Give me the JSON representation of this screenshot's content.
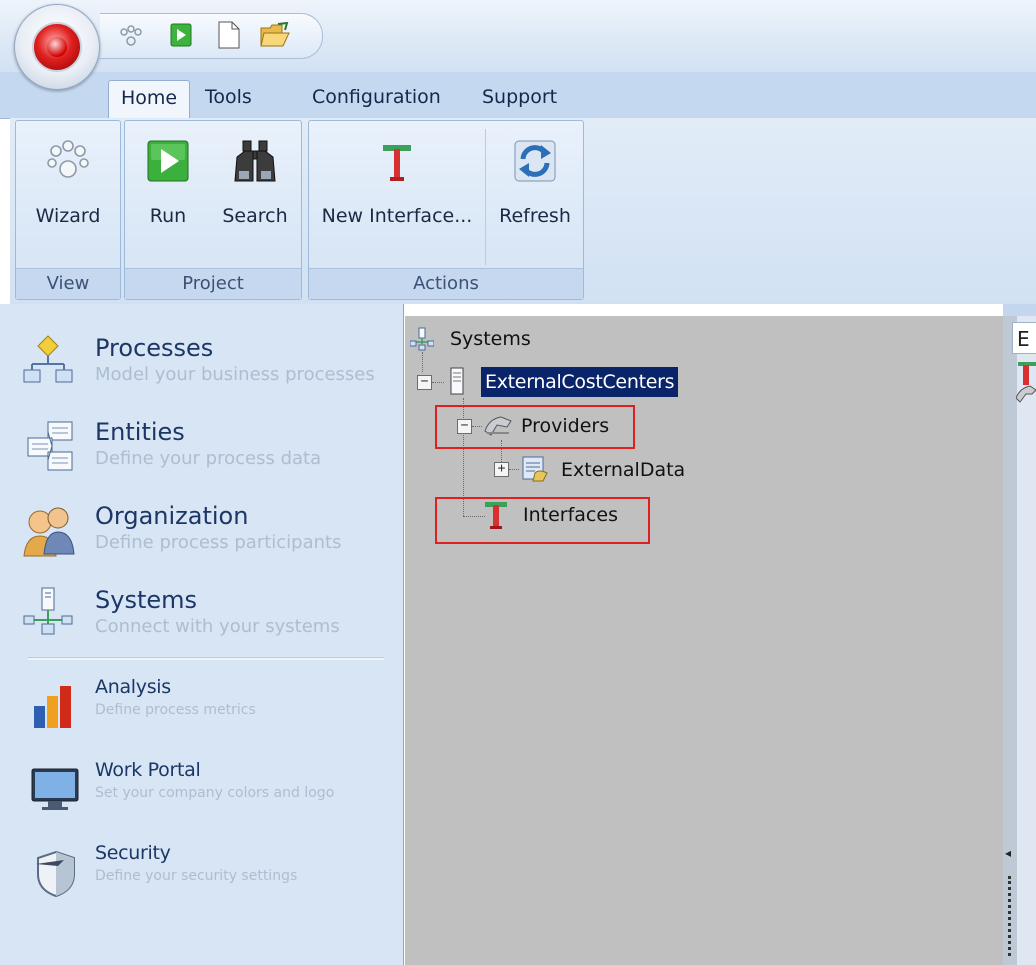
{
  "ribbon": {
    "tabs": [
      "Home",
      "Tools",
      "Configuration",
      "Support"
    ],
    "groups": {
      "view": {
        "label": "View",
        "buttons": {
          "wizard": "Wizard"
        }
      },
      "project": {
        "label": "Project",
        "buttons": {
          "run": "Run",
          "search": "Search"
        }
      },
      "actions": {
        "label": "Actions",
        "buttons": {
          "new_interface": "New Interface...",
          "refresh": "Refresh"
        }
      }
    }
  },
  "nav": {
    "processes": {
      "title": "Processes",
      "subtitle": "Model your business processes"
    },
    "entities": {
      "title": "Entities",
      "subtitle": "Define your process data"
    },
    "organization": {
      "title": "Organization",
      "subtitle": "Define process participants"
    },
    "systems": {
      "title": "Systems",
      "subtitle": "Connect with your systems"
    },
    "analysis": {
      "title": "Analysis",
      "subtitle": "Define process metrics"
    },
    "work_portal": {
      "title": "Work Portal",
      "subtitle": "Set your company colors and logo"
    },
    "security": {
      "title": "Security",
      "subtitle": "Define your security settings"
    }
  },
  "tree": {
    "root": "Systems",
    "system": "ExternalCostCenters",
    "providers": "Providers",
    "external_data": "ExternalData",
    "interfaces": "Interfaces"
  },
  "right_panel": {
    "text": "E"
  },
  "colors": {
    "accent": "#0a246a",
    "highlight_box": "#e02020",
    "tree_bg": "#c0c0c0"
  }
}
